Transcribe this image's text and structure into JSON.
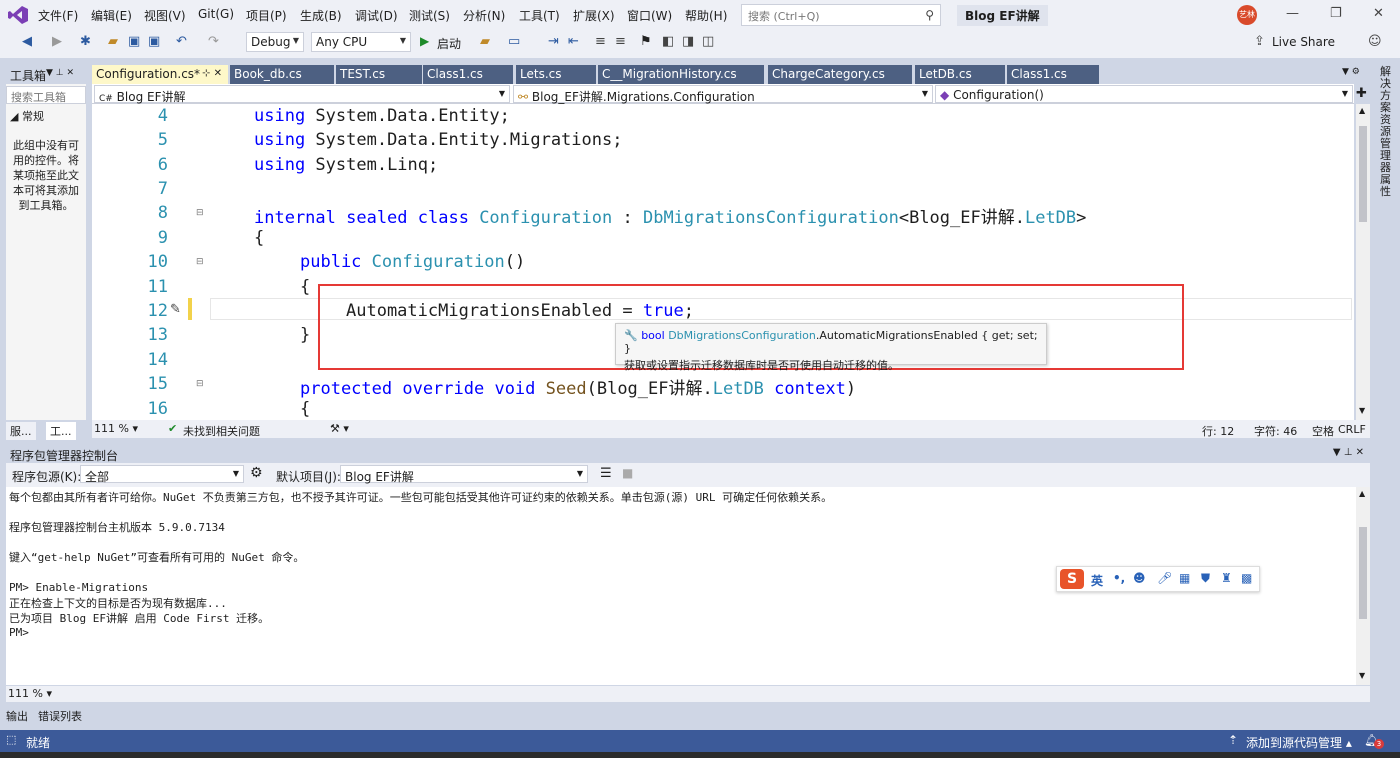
{
  "menu": [
    "文件(F)",
    "编辑(E)",
    "视图(V)",
    "Git(G)",
    "项目(P)",
    "生成(B)",
    "调试(D)",
    "测试(S)",
    "分析(N)",
    "工具(T)",
    "扩展(X)",
    "窗口(W)",
    "帮助(H)"
  ],
  "search_placeholder": "搜索 (Ctrl+Q)",
  "solution_name": "Blog EF讲解",
  "avatar_text": "艺林",
  "toolbar": {
    "config": "Debug",
    "platform": "Any CPU",
    "start": "启动",
    "live_share": "Live Share"
  },
  "toolbox": {
    "title": "工具箱",
    "search": "搜索工具箱",
    "group": "常规",
    "empty_text": "此组中没有可用的控件。将某项拖至此文本可将其添加到工具箱。",
    "tab_left": "服...",
    "tab_right": "工..."
  },
  "tabs": [
    "Configuration.cs*",
    "Book_db.cs",
    "TEST.cs",
    "Class1.cs",
    "Lets.cs",
    "C__MigrationHistory.cs",
    "ChargeCategory.cs",
    "LetDB.cs",
    "Class1.cs"
  ],
  "nav": {
    "project": "Blog EF讲解",
    "type": "Blog_EF讲解.Migrations.Configuration",
    "member": "Configuration()"
  },
  "code": {
    "line_numbers": [
      "4",
      "5",
      "6",
      "7",
      "8",
      "9",
      "10",
      "11",
      "12",
      "13",
      "14",
      "15",
      "16"
    ],
    "l4_kw": "using",
    "l4_rest": " System.Data.Entity;",
    "l5_kw": "using",
    "l5_rest": " System.Data.Entity.Migrations;",
    "l6_kw": "using",
    "l6_rest": " System.Linq;",
    "l8_kw": "internal sealed class",
    "l8_type": "Configuration",
    "l8_colon": " : ",
    "l8_base": "DbMigrationsConfiguration",
    "l8_gen_open": "<Blog_EF讲解.",
    "l8_gen_type": "LetDB",
    "l8_gen_close": ">",
    "l9": "{",
    "l10_kw": "public",
    "l10_type": "Configuration",
    "l10_rest": "()",
    "l11": "{",
    "l12_id": "AutomaticMigrationsEnabled = ",
    "l12_kw": "true",
    "l12_end": ";",
    "l13": "}",
    "l15_kw": "protected override void",
    "l15_method": "Seed",
    "l15_open": "(Blog_EF讲解.",
    "l15_type": "LetDB",
    "l15_param": " context",
    "l15_close": ")",
    "l16": "{"
  },
  "tooltip": {
    "signature_prefix": "bool",
    "signature_type": "DbMigrationsConfiguration",
    "signature_member": ".AutomaticMigrationsEnabled { get; set; }",
    "description": "获取或设置指示迁移数据库时是否可使用自动迁移的值。"
  },
  "editor_status": {
    "zoom": "111 %",
    "issues": "未找到相关问题",
    "line": "行: 12",
    "col": "字符: 46",
    "ws": "空格",
    "eol": "CRLF"
  },
  "pmc": {
    "title": "程序包管理器控制台",
    "source_label": "程序包源(K):",
    "source_value": "全部",
    "project_label": "默认项目(J):",
    "project_value": "Blog EF讲解",
    "lines": [
      "每个包都由其所有者许可给你。NuGet 不负责第三方包，也不授予其许可证。一些包可能包括受其他许可证约束的依赖关系。单击包源(源) URL 可确定任何依赖关系。",
      "",
      "程序包管理器控制台主机版本 5.9.0.7134",
      "",
      "键入“get-help NuGet”可查看所有可用的 NuGet 命令。",
      "",
      "PM> Enable-Migrations",
      "正在检查上下文的目标是否为现有数据库...",
      "已为项目 Blog EF讲解 启用 Code First 迁移。",
      "PM>"
    ],
    "zoom": "111 %"
  },
  "ime": {
    "lang": "英"
  },
  "output_tabs": [
    "输出",
    "错误列表"
  ],
  "right_rail": [
    "解决方案资源管理器",
    "属性"
  ],
  "status": {
    "ready": "就绪",
    "source_control": "添加到源代码管理",
    "notifications": "3"
  }
}
